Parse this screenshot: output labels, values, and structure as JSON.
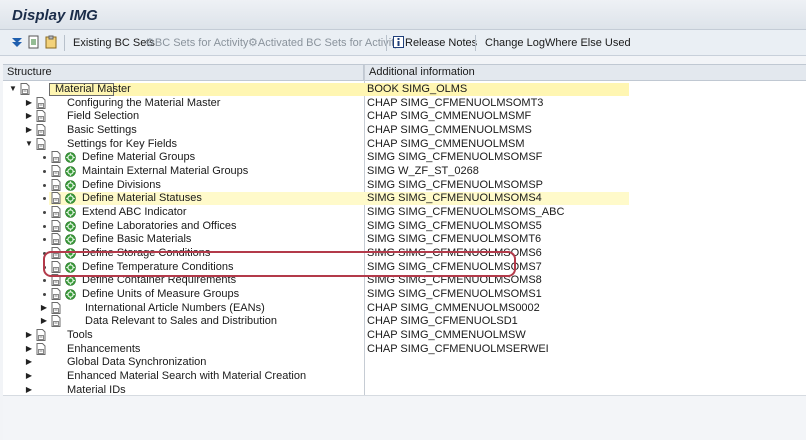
{
  "window": {
    "title": "Display IMG"
  },
  "toolbar": {
    "existing_bc_sets": "Existing BC Sets",
    "bc_sets_for_activity": "BC Sets for Activity",
    "activated_bc_sets": "Activated BC Sets for Activity",
    "release_notes": "Release Notes",
    "change_log": "Change Log",
    "where_else_used": "Where Else Used"
  },
  "columns": {
    "structure": "Structure",
    "additional": "Additional information"
  },
  "tree": [
    {
      "level": 0,
      "expand": "down",
      "icon": "doc",
      "label": "Material Master",
      "info": "BOOK SIMG_OLMS",
      "state": "root"
    },
    {
      "level": 1,
      "expand": "right",
      "icon": "doc",
      "label": "Configuring the Material Master",
      "info": "CHAP SIMG_CFMENUOLMSOMT3"
    },
    {
      "level": 1,
      "expand": "right",
      "icon": "doc",
      "label": "Field Selection",
      "info": "CHAP SIMG_CMMENUOLMSMF"
    },
    {
      "level": 1,
      "expand": "right",
      "icon": "doc",
      "label": "Basic Settings",
      "info": "CHAP SIMG_CMMENUOLMSMS"
    },
    {
      "level": 1,
      "expand": "down",
      "icon": "doc",
      "label": "Settings for Key Fields",
      "info": "CHAP SIMG_CMMENUOLMSM"
    },
    {
      "level": 2,
      "expand": "dot",
      "icon": "doc-exec",
      "label": "Define Material Groups",
      "info": "SIMG SIMG_CFMENUOLMSOMSF"
    },
    {
      "level": 2,
      "expand": "dot",
      "icon": "doc-exec",
      "label": "Maintain External Material Groups",
      "info": "SIMG W_ZF_ST_0268"
    },
    {
      "level": 2,
      "expand": "dot",
      "icon": "doc-exec",
      "label": "Define Divisions",
      "info": "SIMG SIMG_CFMENUOLMSOMSP"
    },
    {
      "level": 2,
      "expand": "dot",
      "icon": "doc-exec",
      "label": "Define Material Statuses",
      "info": "SIMG SIMG_CFMENUOLMSOMS4",
      "state": "hl"
    },
    {
      "level": 2,
      "expand": "dot",
      "icon": "doc-exec",
      "label": "Extend ABC Indicator",
      "info": "SIMG SIMG_CFMENUOLMSOMS_ABC"
    },
    {
      "level": 2,
      "expand": "dot",
      "icon": "doc-exec",
      "label": "Define Laboratories and Offices",
      "info": "SIMG SIMG_CFMENUOLMSOMS5"
    },
    {
      "level": 2,
      "expand": "dot",
      "icon": "doc-exec",
      "label": "Define Basic Materials",
      "info": "SIMG SIMG_CFMENUOLMSOMT6"
    },
    {
      "level": 2,
      "expand": "dot",
      "icon": "doc-exec",
      "label": "Define Storage Conditions",
      "info": "SIMG SIMG_CFMENUOLMSOMS6"
    },
    {
      "level": 2,
      "expand": "dot",
      "icon": "doc-exec",
      "label": "Define Temperature Conditions",
      "info": "SIMG SIMG_CFMENUOLMSOMS7"
    },
    {
      "level": 2,
      "expand": "dot",
      "icon": "doc-exec",
      "label": "Define Container Requirements",
      "info": "SIMG SIMG_CFMENUOLMSOMS8"
    },
    {
      "level": 2,
      "expand": "dot",
      "icon": "doc-exec",
      "label": "Define Units of Measure Groups",
      "info": "SIMG SIMG_CFMENUOLMSOMS1"
    },
    {
      "level": 2,
      "expand": "right",
      "icon": "doc",
      "label": "International Article Numbers (EANs)",
      "info": "CHAP SIMG_CMMENUOLMS0002"
    },
    {
      "level": 2,
      "expand": "right",
      "icon": "doc",
      "label": "Data Relevant to Sales and Distribution",
      "info": "CHAP SIMG_CFMENUOLSD1"
    },
    {
      "level": 1,
      "expand": "right",
      "icon": "doc",
      "label": "Tools",
      "info": "CHAP SIMG_CMMENUOLMSW"
    },
    {
      "level": 1,
      "expand": "right",
      "icon": "doc",
      "label": "Enhancements",
      "info": "CHAP SIMG_CFMENUOLMSERWEI"
    },
    {
      "level": 1,
      "expand": "right",
      "icon": "none",
      "label": "Global Data Synchronization",
      "info": ""
    },
    {
      "level": 1,
      "expand": "right",
      "icon": "none",
      "label": "Enhanced Material Search with Material Creation",
      "info": ""
    },
    {
      "level": 1,
      "expand": "right",
      "icon": "none",
      "label": "Material IDs",
      "info": ""
    }
  ],
  "colors": {
    "highlight": "#fffaca",
    "callout": "#b33a4a",
    "title": "#1b2d4a"
  }
}
